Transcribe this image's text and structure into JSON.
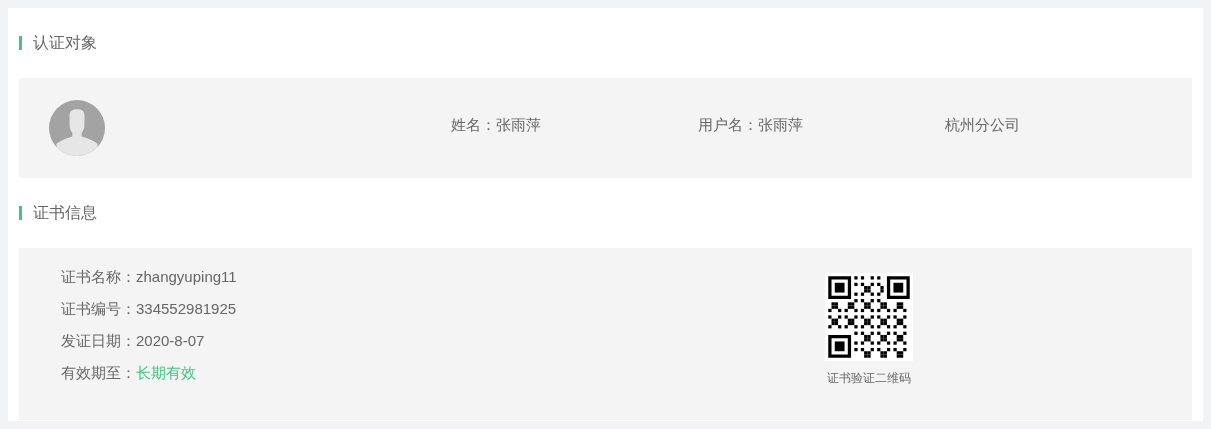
{
  "subject": {
    "title": "认证对象",
    "fields": [
      {
        "text": "姓名：张雨萍"
      },
      {
        "text": "用户名：张雨萍"
      },
      {
        "text": "杭州分公司"
      }
    ]
  },
  "certificate": {
    "title": "证书信息",
    "fields": [
      {
        "label": "证书名称：",
        "value": "zhangyuping11",
        "kind": "plain"
      },
      {
        "label": "证书编号：",
        "value": "334552981925",
        "kind": "plain"
      },
      {
        "label": "发证日期：",
        "value": "2020-8-07",
        "kind": "plain"
      },
      {
        "label": "有效期至：",
        "value": "长期有效",
        "kind": "highlight"
      }
    ],
    "qr_caption": "证书验证二维码"
  }
}
